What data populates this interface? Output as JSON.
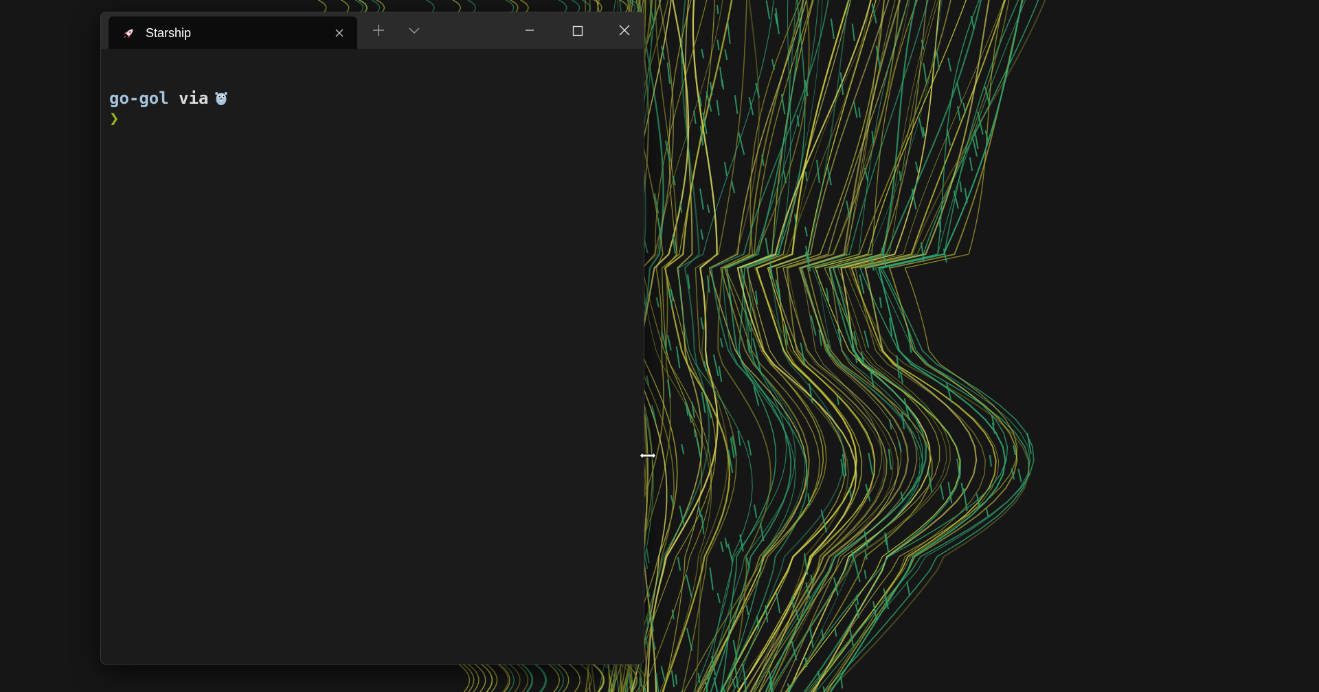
{
  "desktop": {
    "wallpaper": "abstract-flowing-lines",
    "background_color": "#161616",
    "line_colors": [
      "#c8c83a",
      "#2ea36e",
      "#8a8a2a",
      "#d8d860"
    ]
  },
  "window": {
    "tab": {
      "title": "Starship",
      "icon": "rocket-icon"
    },
    "icons": {
      "tab_close": "close-icon",
      "new_tab": "plus-icon",
      "dropdown": "chevron-down-icon",
      "minimize": "minimize-icon",
      "maximize": "maximize-icon",
      "close": "close-icon"
    },
    "terminal": {
      "directory": "go-gol",
      "via": "via",
      "language_icon": "gopher-icon",
      "prompt_symbol": "❯",
      "prompt_color": "#98b31e",
      "directory_color": "#a7c4de"
    }
  },
  "cursor": {
    "type": "horizontal-resize-cursor"
  }
}
